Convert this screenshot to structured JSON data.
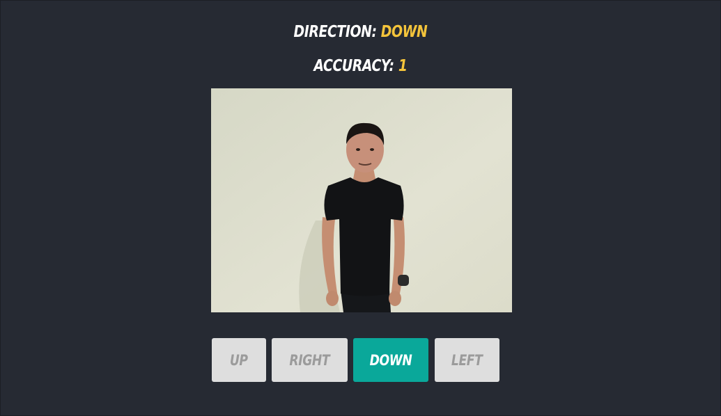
{
  "status": {
    "direction_label": "Direction:",
    "direction_value": "DOWN",
    "accuracy_label": "Accuracy:",
    "accuracy_value": "1"
  },
  "controls": {
    "up_label": "UP",
    "right_label": "RIGHT",
    "down_label": "DOWN",
    "left_label": "LEFT",
    "active": "down"
  },
  "colors": {
    "background": "#262a33",
    "accent_value": "#f4c43b",
    "active_button": "#0aa89a",
    "inactive_button": "#dedede"
  }
}
